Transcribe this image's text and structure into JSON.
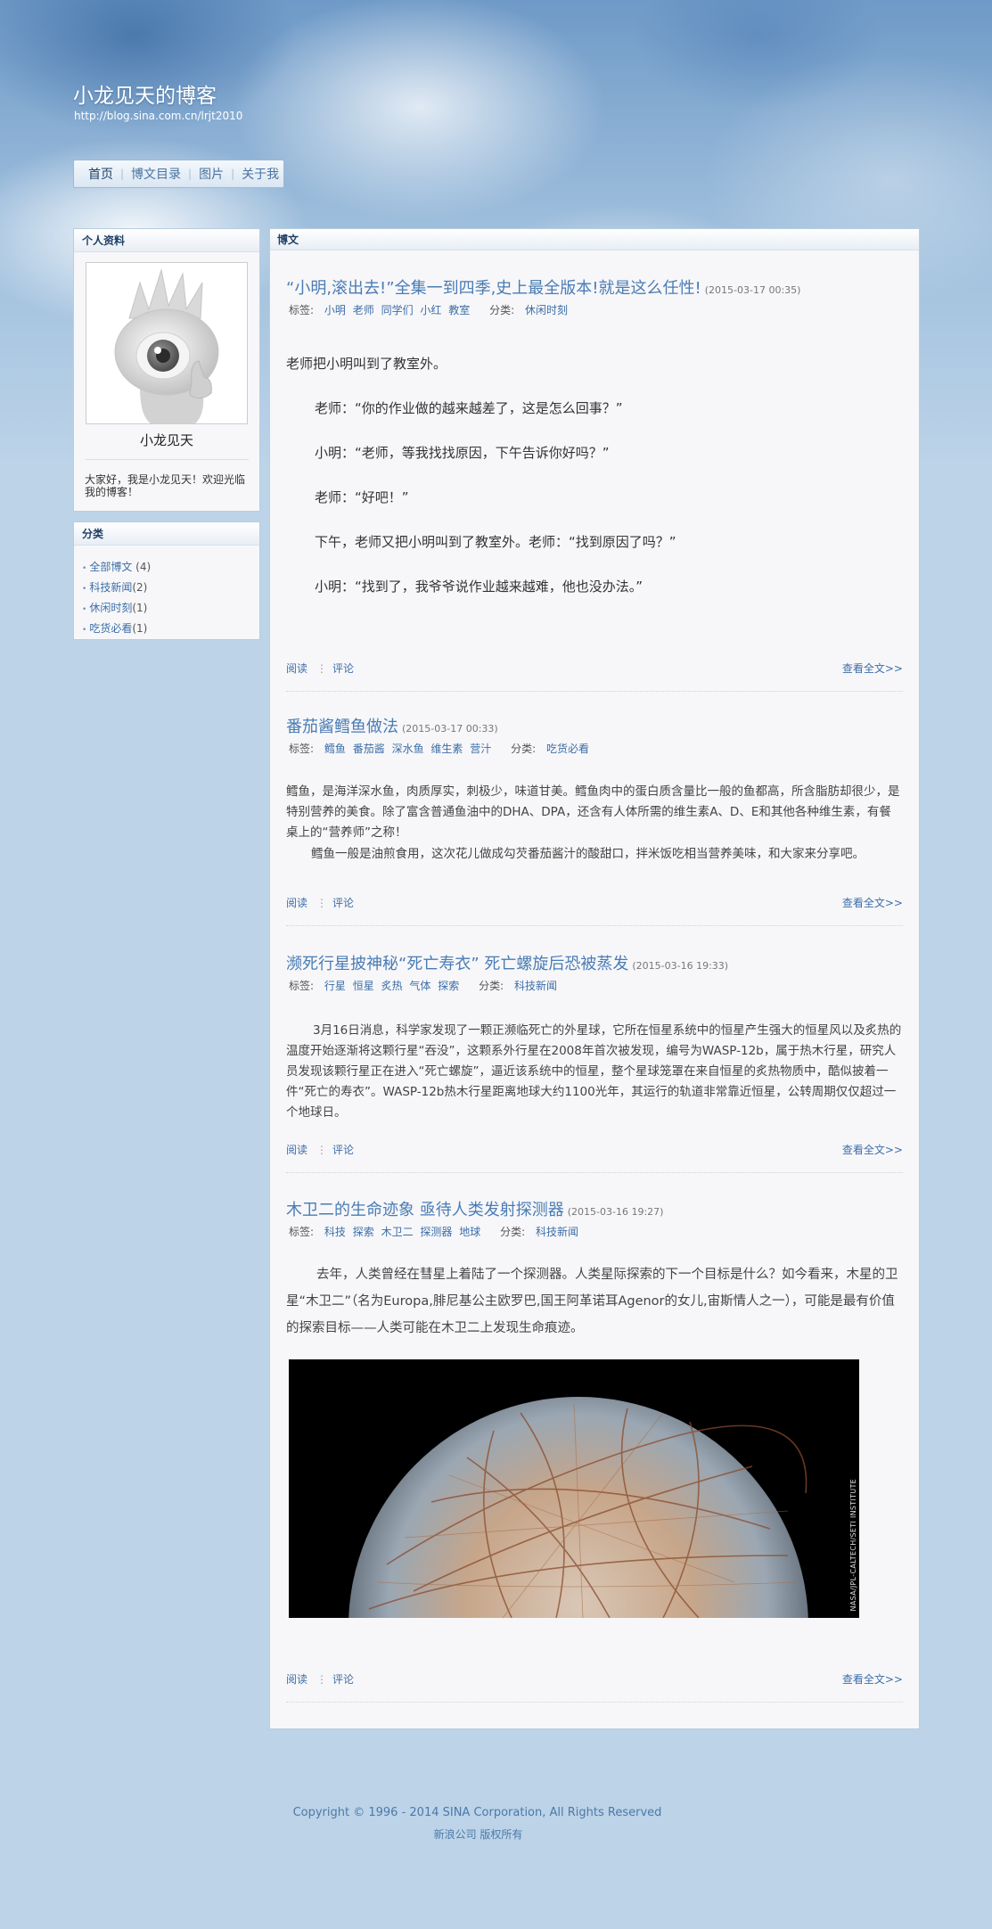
{
  "header": {
    "blog_title": "小龙见天的博客",
    "blog_url": "http://blog.sina.com.cn/lrjt2010"
  },
  "nav": {
    "items": [
      {
        "label": "首页"
      },
      {
        "label": "博文目录"
      },
      {
        "label": "图片"
      },
      {
        "label": "关于我"
      }
    ]
  },
  "profile": {
    "title": "个人资料",
    "name": "小龙见天",
    "intro": "大家好，我是小龙见天！欢迎光临我的博客！"
  },
  "category": {
    "title": "分类",
    "items": [
      {
        "label": "全部博文",
        "count": "(4)"
      },
      {
        "label": "科技新闻",
        "count": "(2)"
      },
      {
        "label": "休闲时刻",
        "count": "(1)"
      },
      {
        "label": "吃货必看",
        "count": "(1)"
      }
    ]
  },
  "main": {
    "title": "博文",
    "tags_label": "标签:",
    "category_label": "分类:",
    "read_label": "阅读",
    "comment_label": "评论",
    "more_label": "查看全文>>",
    "posts": [
      {
        "title": "“小明,滚出去!”全集一到四季,史上最全版本!就是这么任性!",
        "date": "(2015-03-17 00:35)",
        "tags": [
          "小明",
          "老师",
          "同学们",
          "小红",
          "教室"
        ],
        "category": "休闲时刻",
        "paragraphs": [
          "老师把小明叫到了教室外。",
          "老师：“你的作业做的越来越差了，这是怎么回事？”",
          "小明：“老师，等我找找原因，下午告诉你好吗？”",
          "老师：“好吧！”",
          "下午，老师又把小明叫到了教室外。老师：“找到原因了吗？”",
          "小明：“找到了，我爷爷说作业越来越难，他也没办法。”"
        ]
      },
      {
        "title": "番茄酱鳕鱼做法",
        "date": "(2015-03-17 00:33)",
        "tags": [
          "鳕鱼",
          "番茄酱",
          "深水鱼",
          "维生素",
          "营汁"
        ],
        "category": "吃货必看",
        "paragraphs": [
          "鳕鱼，是海洋深水鱼，肉质厚实，刺极少，味道甘美。鳕鱼肉中的蛋白质含量比一般的鱼都高，所含脂肪却很少，是特别营养的美食。除了富含普通鱼油中的DHA、DPA，还含有人体所需的维生素A、D、E和其他各种维生素，有餐桌上的“营养师”之称！",
          "鳕鱼一般是油煎食用，这次花儿做成勾芡番茄酱汁的酸甜口，拌米饭吃相当营养美味，和大家来分享吧。"
        ]
      },
      {
        "title": "濒死行星披神秘“死亡寿衣” 死亡螺旋后恐被蒸发",
        "date": "(2015-03-16 19:33)",
        "tags": [
          "行星",
          "恒星",
          "炙热",
          "气体",
          "探索"
        ],
        "category": "科技新闻",
        "paragraphs": [
          "3月16日消息，科学家发现了一颗正濒临死亡的外星球，它所在恒星系统中的恒星产生强大的恒星风以及炙热的温度开始逐渐将这颗行星“吞没”，这颗系外行星在2008年首次被发现，编号为WASP-12b，属于热木行星，研究人员发现该颗行星正在进入“死亡螺旋”，逼近该系统中的恒星，整个星球笼罩在来自恒星的炙热物质中，酷似披着一件“死亡的寿衣”。WASP-12b热木行星距离地球大约1100光年，其运行的轨道非常靠近恒星，公转周期仅仅超过一个地球日。"
        ]
      },
      {
        "title": "木卫二的生命迹象 亟待人类发射探测器",
        "date": "(2015-03-16 19:27)",
        "tags": [
          "科技",
          "探索",
          "木卫二",
          "探测器",
          "地球"
        ],
        "category": "科技新闻",
        "paragraphs": [
          "去年，人类曾经在彗星上着陆了一个探测器。人类星际探索的下一个目标是什么？如今看来，木星的卫星“木卫二”（名为Europa,腓尼基公主欧罗巴,国王阿革诺耳Agenor的女儿,宙斯情人之一），可能是最有价值的探索目标——人类可能在木卫二上发现生命痕迹。"
        ],
        "image_credit": "NASA/JPL-CALTECH/SETI INSTITUTE"
      }
    ]
  },
  "footer": {
    "copyright": "Copyright © 1996 - 2014 SINA Corporation, All Rights Reserved",
    "company": "新浪公司 版权所有"
  }
}
